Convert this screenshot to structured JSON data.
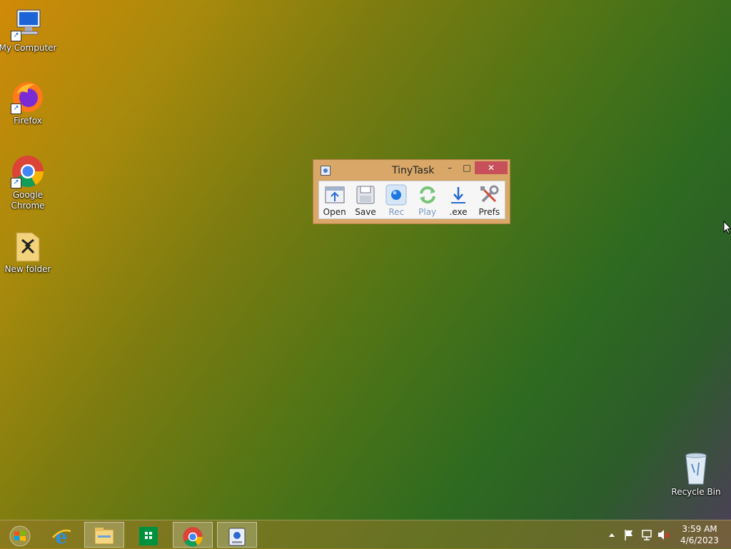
{
  "desktop": {
    "icons": [
      {
        "label": "My Computer"
      },
      {
        "label": "Firefox"
      },
      {
        "label": "Google Chrome"
      },
      {
        "label": "New folder"
      },
      {
        "label": "Recycle Bin"
      }
    ]
  },
  "window": {
    "title": "TinyTask",
    "minimize_label": "–",
    "maximize_label": "□",
    "close_label": "✕",
    "tools": [
      {
        "label": "Open",
        "icon": "open-icon"
      },
      {
        "label": "Save",
        "icon": "save-icon"
      },
      {
        "label": "Rec",
        "icon": "record-icon"
      },
      {
        "label": "Play",
        "icon": "play-icon"
      },
      {
        "label": ".exe",
        "icon": "compile-exe-icon"
      },
      {
        "label": "Prefs",
        "icon": "prefs-icon"
      }
    ]
  },
  "taskbar": {
    "items": [
      {
        "icon": "start-icon"
      },
      {
        "icon": "internet-explorer-icon"
      },
      {
        "icon": "file-explorer-icon"
      },
      {
        "icon": "store-icon"
      },
      {
        "icon": "chrome-icon"
      },
      {
        "icon": "tinytask-icon"
      }
    ],
    "tray": {
      "icons": [
        "show-hidden-icons-icon",
        "action-center-flag-icon",
        "network-icon",
        "volume-muted-icon"
      ]
    },
    "clock": {
      "time": "3:59 AM",
      "date": "4/6/2023"
    }
  }
}
